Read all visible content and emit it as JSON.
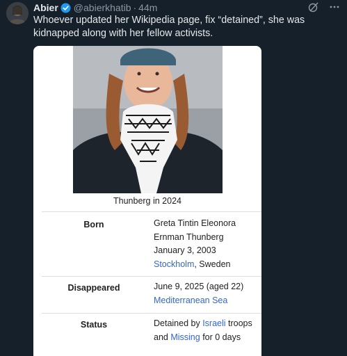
{
  "tweet": {
    "author": "Abier",
    "handle": "@abierkhatib",
    "separator": "·",
    "time": "44m",
    "text": "Whoever updated her Wikipedia page, fix “detained”, she was kidnapped along with her fellow activists."
  },
  "card": {
    "caption": "Thunberg in 2024",
    "rows": [
      {
        "label": "Born",
        "lines": [
          "Greta Tintin Eleonora",
          "Ernman Thunberg",
          "January 3, 2003"
        ],
        "place_link": "Stockholm",
        "place_rest": ", Sweden"
      },
      {
        "label": "Disappeared",
        "date": "June 9, 2025 (aged 22)",
        "place_link": "Mediterranean Sea"
      },
      {
        "label": "Status",
        "prefix": "Detained by ",
        "link1": "Israeli",
        "mid": " troops",
        "line2_prefix": "and ",
        "link2": "Missing",
        "suffix": " for 0 days"
      }
    ]
  },
  "colors": {
    "background": "#15202b",
    "verified": "#1d9bf0",
    "link": "#3366cc"
  },
  "icons": [
    "verified-badge-icon",
    "grok-icon",
    "more-icon"
  ]
}
